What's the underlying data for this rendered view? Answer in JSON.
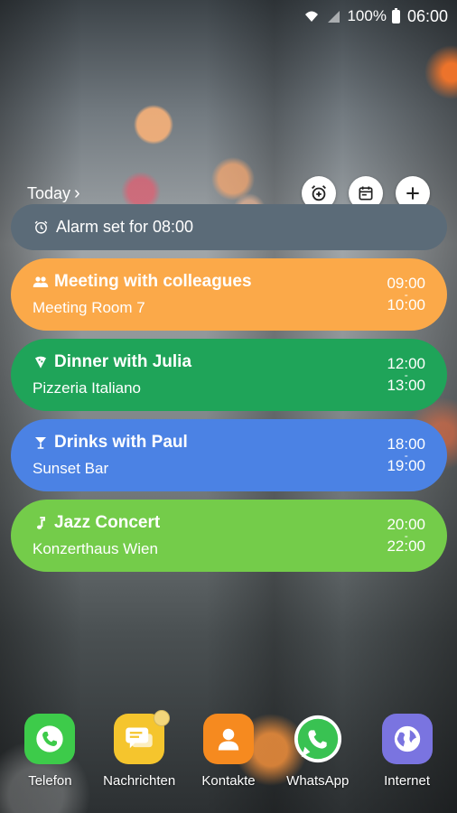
{
  "status_bar": {
    "battery_text": "100%",
    "time": "06:00"
  },
  "header": {
    "today_label": "Today"
  },
  "alarm": {
    "text": "Alarm set for 08:00"
  },
  "events": [
    {
      "title": "Meeting with colleagues",
      "location": "Meeting Room  7",
      "start": "09:00",
      "end": "10:00",
      "color": "#FBA949",
      "icon": "people-icon"
    },
    {
      "title": "Dinner with Julia",
      "location": "Pizzeria Italiano",
      "start": "12:00",
      "end": "13:00",
      "color": "#1FA459",
      "icon": "pizza-icon"
    },
    {
      "title": "Drinks with Paul",
      "location": "Sunset Bar",
      "start": "18:00",
      "end": "19:00",
      "color": "#4B82E4",
      "icon": "cocktail-icon"
    },
    {
      "title": "Jazz Concert",
      "location": "Konzerthaus Wien",
      "start": "20:00",
      "end": "22:00",
      "color": "#74CC4A",
      "icon": "music-note-icon"
    }
  ],
  "time_separator": "-",
  "dock": [
    {
      "label": "Telefon",
      "icon": "phone-icon",
      "color": "#3DCB4A"
    },
    {
      "label": "Nachrichten",
      "icon": "messages-icon",
      "color": "#F5C52D"
    },
    {
      "label": "Kontakte",
      "icon": "contacts-icon",
      "color": "#F68A1F"
    },
    {
      "label": "WhatsApp",
      "icon": "whatsapp-icon",
      "color": "#39C252"
    },
    {
      "label": "Internet",
      "icon": "globe-icon",
      "color": "#7A74E0"
    }
  ]
}
